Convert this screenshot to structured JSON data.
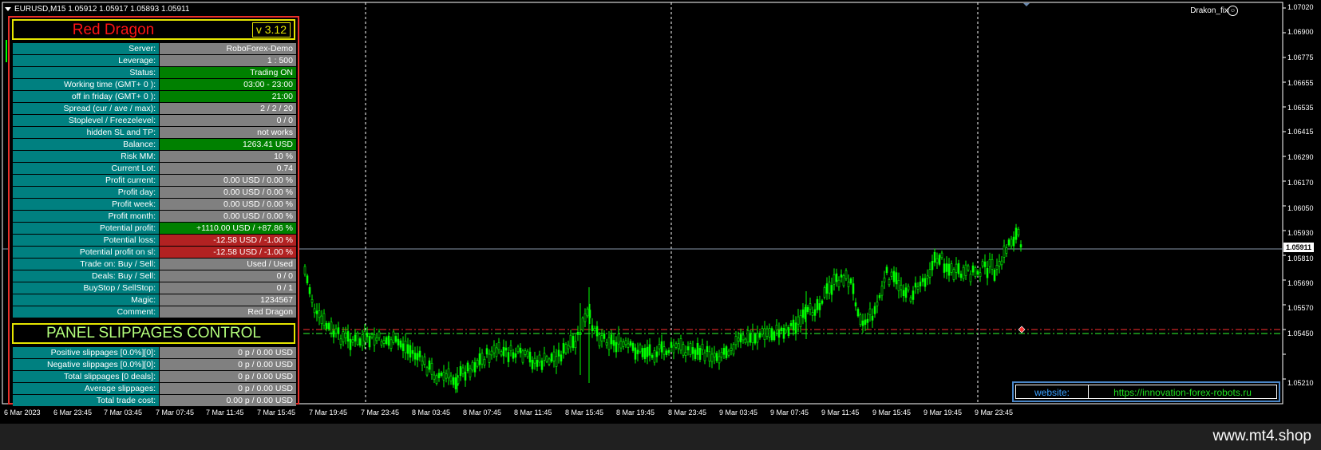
{
  "header": {
    "symbol_info": "EURUSD,M15  1.05912 1.05917 1.05893 1.05911",
    "ea_name": "Drakon_fix",
    "ea_smile": "☺"
  },
  "price_axis": {
    "labels": [
      "1.07020",
      "1.06900",
      "1.06775",
      "1.06655",
      "1.06535",
      "1.06415",
      "1.06290",
      "1.06170",
      "1.06050",
      "1.05930",
      "1.05810",
      "1.05690",
      "1.05570",
      "1.05450",
      "1.05210"
    ],
    "current_price": "1.05911"
  },
  "time_axis": {
    "labels": [
      "6 Mar 2023",
      "6 Mar 23:45",
      "7 Mar 03:45",
      "7 Mar 07:45",
      "7 Mar 11:45",
      "7 Mar 15:45",
      "7 Mar 19:45",
      "7 Mar 23:45",
      "8 Mar 03:45",
      "8 Mar 07:45",
      "8 Mar 11:45",
      "8 Mar 15:45",
      "8 Mar 19:45",
      "8 Mar 23:45",
      "9 Mar 03:45",
      "9 Mar 07:45",
      "9 Mar 11:45",
      "9 Mar 15:45",
      "9 Mar 19:45",
      "9 Mar 23:45"
    ]
  },
  "panel": {
    "title": "Red Dragon",
    "version": "v 3.12",
    "rows": [
      {
        "label": "Server:",
        "value": "RoboForex-Demo",
        "status": "normal"
      },
      {
        "label": "Leverage:",
        "value": "1 : 500",
        "status": "normal"
      },
      {
        "label": "Status:",
        "value": "Trading ON",
        "status": "green"
      },
      {
        "label": "Working time (GMT+ 0 ):",
        "value": "03:00 - 23:00",
        "status": "green"
      },
      {
        "label": "off in friday (GMT+ 0 ):",
        "value": "21:00",
        "status": "green"
      },
      {
        "label": "Spread (cur / ave / max):",
        "value": "2 / 2 / 20",
        "status": "normal"
      },
      {
        "label": "Stoplevel  /  Freezelevel:",
        "value": "0  /  0",
        "status": "normal"
      },
      {
        "label": "hidden SL and TP:",
        "value": "not works",
        "status": "normal"
      },
      {
        "label": "Balance:",
        "value": "1263.41 USD",
        "status": "green"
      },
      {
        "label": "Risk MM:",
        "value": "10 %",
        "status": "normal"
      },
      {
        "label": "Current Lot:",
        "value": "0.74",
        "status": "normal"
      },
      {
        "label": "Profit current:",
        "value": "0.00 USD / 0.00 %",
        "status": "normal"
      },
      {
        "label": "Profit day:",
        "value": "0.00 USD / 0.00 %",
        "status": "normal"
      },
      {
        "label": "Profit week:",
        "value": "0.00 USD / 0.00 %",
        "status": "normal"
      },
      {
        "label": "Profit month:",
        "value": "0.00 USD / 0.00 %",
        "status": "normal"
      },
      {
        "label": "Potential profit:",
        "value": "+1110.00 USD / +87.86 %",
        "status": "green"
      },
      {
        "label": "Potential loss:",
        "value": "-12.58 USD / -1.00 %",
        "status": "red"
      },
      {
        "label": "Potential profit on sl:",
        "value": "-12.58 USD / -1.00 %",
        "status": "red"
      },
      {
        "label": "Trade on: Buy  /  Sell:",
        "value": "Used  /  Used",
        "status": "normal"
      },
      {
        "label": "Deals: Buy / Sell:",
        "value": "0  /  0",
        "status": "normal"
      },
      {
        "label": "BuyStop / SellStop:",
        "value": "0  /  1",
        "status": "normal"
      },
      {
        "label": "Magic:",
        "value": "1234567",
        "status": "normal"
      },
      {
        "label": "Comment:",
        "value": "Red Dragon",
        "status": "normal"
      }
    ],
    "slippage_title": "PANEL SLIPPAGES CONTROL",
    "slippage_rows": [
      {
        "label": "Positive slippages [0.0%][0]:",
        "value": "0 p / 0.00 USD"
      },
      {
        "label": "Negative slippages [0.0%][0]:",
        "value": "0 p / 0.00 USD"
      },
      {
        "label": "Total slippages [0 deals]:",
        "value": "0 p / 0.00 USD"
      },
      {
        "label": "Average slippages:",
        "value": "0 p / 0.00 USD"
      },
      {
        "label": "Total trade cost:",
        "value": "0.00 p / 0.00 USD"
      }
    ]
  },
  "website": {
    "label": "website:",
    "url": "https://innovation-forex-robots.ru"
  },
  "footer": {
    "brand": "www.mt4.shop"
  },
  "colors": {
    "candle": "#00ff00",
    "panel_border": "#e8302a",
    "title_red": "#ff1414",
    "teal": "#008080",
    "gray": "#808080",
    "green": "#008000",
    "red": "#b22222"
  }
}
